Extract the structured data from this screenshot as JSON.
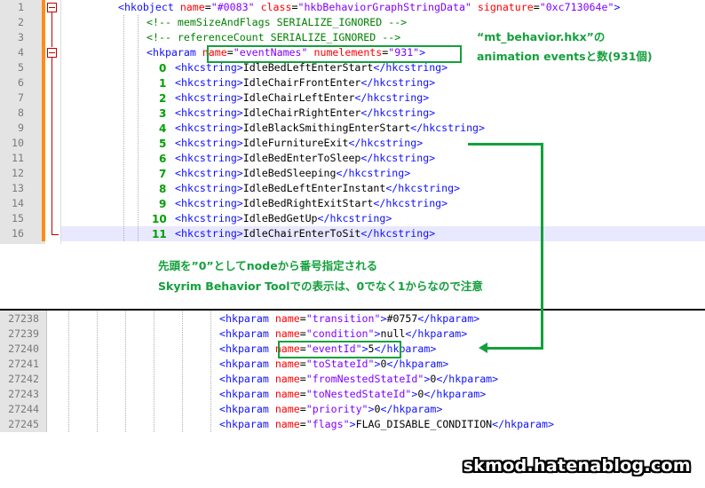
{
  "editor_top": {
    "lines": [
      {
        "num": "1",
        "idx": "",
        "parts": [
          {
            "c": "tag",
            "t": "<hkobject "
          },
          {
            "c": "attr",
            "t": "name"
          },
          {
            "c": "eq",
            "t": "="
          },
          {
            "c": "val",
            "t": "\"#0083\""
          },
          {
            "c": "txt",
            "t": " "
          },
          {
            "c": "attr",
            "t": "class"
          },
          {
            "c": "eq",
            "t": "="
          },
          {
            "c": "val",
            "t": "\"hkbBehaviorGraphStringData\""
          },
          {
            "c": "txt",
            "t": " "
          },
          {
            "c": "attr",
            "t": "signature"
          },
          {
            "c": "eq",
            "t": "="
          },
          {
            "c": "val",
            "t": "\"0xc713064e\""
          },
          {
            "c": "tag",
            "t": ">"
          }
        ]
      },
      {
        "num": "2",
        "idx": "",
        "parts": [
          {
            "c": "cmt",
            "t": "<!-- memSizeAndFlags SERIALIZE_IGNORED -->"
          }
        ]
      },
      {
        "num": "3",
        "idx": "",
        "parts": [
          {
            "c": "cmt",
            "t": "<!-- referenceCount SERIALIZE_IGNORED -->"
          }
        ]
      },
      {
        "num": "4",
        "idx": "",
        "parts": [
          {
            "c": "tag",
            "t": "<hkparam "
          },
          {
            "c": "attr",
            "t": "name"
          },
          {
            "c": "eq",
            "t": "="
          },
          {
            "c": "val",
            "t": "\"eventNames\""
          },
          {
            "c": "txt",
            "t": " "
          },
          {
            "c": "attr",
            "t": "numelements"
          },
          {
            "c": "eq",
            "t": "="
          },
          {
            "c": "val",
            "t": "\"931\""
          },
          {
            "c": "tag",
            "t": ">"
          }
        ]
      },
      {
        "num": "5",
        "idx": "0",
        "parts": [
          {
            "c": "tag",
            "t": "<hkcstring>"
          },
          {
            "c": "txt",
            "t": "IdleBedLeftEnterStart"
          },
          {
            "c": "tag",
            "t": "</hkcstring>"
          }
        ]
      },
      {
        "num": "6",
        "idx": "1",
        "parts": [
          {
            "c": "tag",
            "t": "<hkcstring>"
          },
          {
            "c": "txt",
            "t": "IdleChairFrontEnter"
          },
          {
            "c": "tag",
            "t": "</hkcstring>"
          }
        ]
      },
      {
        "num": "7",
        "idx": "2",
        "parts": [
          {
            "c": "tag",
            "t": "<hkcstring>"
          },
          {
            "c": "txt",
            "t": "IdleChairLeftEnter"
          },
          {
            "c": "tag",
            "t": "</hkcstring>"
          }
        ]
      },
      {
        "num": "8",
        "idx": "3",
        "parts": [
          {
            "c": "tag",
            "t": "<hkcstring>"
          },
          {
            "c": "txt",
            "t": "IdleChairRightEnter"
          },
          {
            "c": "tag",
            "t": "</hkcstring>"
          }
        ]
      },
      {
        "num": "9",
        "idx": "4",
        "parts": [
          {
            "c": "tag",
            "t": "<hkcstring>"
          },
          {
            "c": "txt",
            "t": "IdleBlackSmithingEnterStart"
          },
          {
            "c": "tag",
            "t": "</hkcstring>"
          }
        ]
      },
      {
        "num": "10",
        "idx": "5",
        "parts": [
          {
            "c": "tag",
            "t": "<hkcstring>"
          },
          {
            "c": "txt",
            "t": "IdleFurnitureExit"
          },
          {
            "c": "tag",
            "t": "</hkcstring>"
          }
        ]
      },
      {
        "num": "11",
        "idx": "6",
        "parts": [
          {
            "c": "tag",
            "t": "<hkcstring>"
          },
          {
            "c": "txt",
            "t": "IdleBedEnterToSleep"
          },
          {
            "c": "tag",
            "t": "</hkcstring>"
          }
        ]
      },
      {
        "num": "12",
        "idx": "7",
        "parts": [
          {
            "c": "tag",
            "t": "<hkcstring>"
          },
          {
            "c": "txt",
            "t": "IdleBedSleeping"
          },
          {
            "c": "tag",
            "t": "</hkcstring>"
          }
        ]
      },
      {
        "num": "13",
        "idx": "8",
        "parts": [
          {
            "c": "tag",
            "t": "<hkcstring>"
          },
          {
            "c": "txt",
            "t": "IdleBedLeftEnterInstant"
          },
          {
            "c": "tag",
            "t": "</hkcstring>"
          }
        ]
      },
      {
        "num": "14",
        "idx": "9",
        "parts": [
          {
            "c": "tag",
            "t": "<hkcstring>"
          },
          {
            "c": "txt",
            "t": "IdleBedRightExitStart"
          },
          {
            "c": "tag",
            "t": "</hkcstring>"
          }
        ]
      },
      {
        "num": "15",
        "idx": "10",
        "parts": [
          {
            "c": "tag",
            "t": "<hkcstring>"
          },
          {
            "c": "txt",
            "t": "IdleBedGetUp"
          },
          {
            "c": "tag",
            "t": "</hkcstring>"
          }
        ]
      },
      {
        "num": "16",
        "idx": "11",
        "parts": [
          {
            "c": "tag",
            "t": "<hkcstring>"
          },
          {
            "c": "txt",
            "t": "IdleChairEnterToSit"
          },
          {
            "c": "tag",
            "t": "</hkcstring>"
          }
        ]
      }
    ]
  },
  "editor_bottom": {
    "lines": [
      {
        "num": "27238",
        "parts": [
          {
            "c": "tag",
            "t": "<hkparam "
          },
          {
            "c": "attr",
            "t": "name"
          },
          {
            "c": "eq",
            "t": "="
          },
          {
            "c": "val",
            "t": "\"transition\""
          },
          {
            "c": "tag",
            "t": ">"
          },
          {
            "c": "txt",
            "t": "#0757"
          },
          {
            "c": "tag",
            "t": "</hkparam>"
          }
        ]
      },
      {
        "num": "27239",
        "parts": [
          {
            "c": "tag",
            "t": "<hkparam "
          },
          {
            "c": "attr",
            "t": "name"
          },
          {
            "c": "eq",
            "t": "="
          },
          {
            "c": "val",
            "t": "\"condition\""
          },
          {
            "c": "tag",
            "t": ">"
          },
          {
            "c": "txt",
            "t": "null"
          },
          {
            "c": "tag",
            "t": "</hkparam>"
          }
        ]
      },
      {
        "num": "27240",
        "parts": [
          {
            "c": "tag",
            "t": "<hkparam "
          },
          {
            "c": "attr",
            "t": "name"
          },
          {
            "c": "eq",
            "t": "="
          },
          {
            "c": "val",
            "t": "\"eventId\""
          },
          {
            "c": "tag",
            "t": ">"
          },
          {
            "c": "txt",
            "t": "5"
          },
          {
            "c": "tag",
            "t": "</hkparam>"
          }
        ]
      },
      {
        "num": "27241",
        "parts": [
          {
            "c": "tag",
            "t": "<hkparam "
          },
          {
            "c": "attr",
            "t": "name"
          },
          {
            "c": "eq",
            "t": "="
          },
          {
            "c": "val",
            "t": "\"toStateId\""
          },
          {
            "c": "tag",
            "t": ">"
          },
          {
            "c": "txt",
            "t": "0"
          },
          {
            "c": "tag",
            "t": "</hkparam>"
          }
        ]
      },
      {
        "num": "27242",
        "parts": [
          {
            "c": "tag",
            "t": "<hkparam "
          },
          {
            "c": "attr",
            "t": "name"
          },
          {
            "c": "eq",
            "t": "="
          },
          {
            "c": "val",
            "t": "\"fromNestedStateId\""
          },
          {
            "c": "tag",
            "t": ">"
          },
          {
            "c": "txt",
            "t": "0"
          },
          {
            "c": "tag",
            "t": "</hkparam>"
          }
        ]
      },
      {
        "num": "27243",
        "parts": [
          {
            "c": "tag",
            "t": "<hkparam "
          },
          {
            "c": "attr",
            "t": "name"
          },
          {
            "c": "eq",
            "t": "="
          },
          {
            "c": "val",
            "t": "\"toNestedStateId\""
          },
          {
            "c": "tag",
            "t": ">"
          },
          {
            "c": "txt",
            "t": "0"
          },
          {
            "c": "tag",
            "t": "</hkparam>"
          }
        ]
      },
      {
        "num": "27244",
        "parts": [
          {
            "c": "tag",
            "t": "<hkparam "
          },
          {
            "c": "attr",
            "t": "name"
          },
          {
            "c": "eq",
            "t": "="
          },
          {
            "c": "val",
            "t": "\"priority\""
          },
          {
            "c": "tag",
            "t": ">"
          },
          {
            "c": "txt",
            "t": "0"
          },
          {
            "c": "tag",
            "t": "</hkparam>"
          }
        ]
      },
      {
        "num": "27245",
        "parts": [
          {
            "c": "tag",
            "t": "<hkparam "
          },
          {
            "c": "attr",
            "t": "name"
          },
          {
            "c": "eq",
            "t": "="
          },
          {
            "c": "val",
            "t": "\"flags\""
          },
          {
            "c": "tag",
            "t": ">"
          },
          {
            "c": "txt",
            "t": "FLAG_DISABLE_CONDITION"
          },
          {
            "c": "tag",
            "t": "</hkparam>"
          }
        ]
      }
    ]
  },
  "annotations": {
    "note_top_line1": "“mt_behavior.hkx”の",
    "note_top_line2": "animation eventsと数(931個)",
    "note_mid_line1": "先頭を”0”としてnodeから番号指定される",
    "note_mid_line2": "Skyrim Behavior Toolでの表示は、0でなく1からなので注意"
  },
  "watermark": "skmod.hatenablog.com",
  "colors": {
    "accent_green": "#14a03c",
    "tag": "#1010ff",
    "attr": "#ff0000",
    "value": "#8000ff",
    "comment": "#008000",
    "change_bar": "#ff8c1a"
  }
}
